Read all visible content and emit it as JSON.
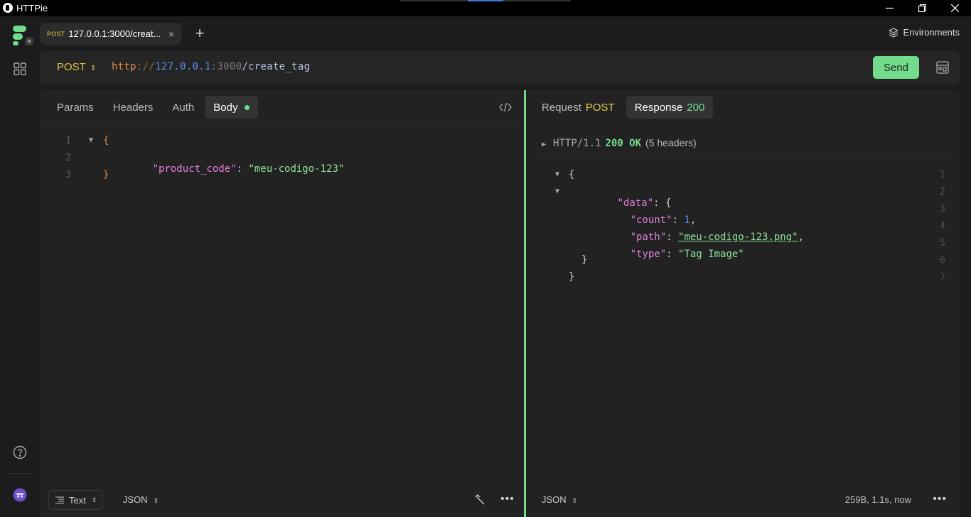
{
  "window": {
    "title": "HTTPie",
    "controls": [
      "minimize-icon",
      "restore-icon",
      "close-icon"
    ]
  },
  "tabs": [
    {
      "method": "POST",
      "label": "127.0.0.1:3000/creat...",
      "close": "×"
    }
  ],
  "new_tab_label": "+",
  "environments_label": "Environments",
  "request": {
    "method": "POST",
    "method_arrows": "⇕",
    "url": {
      "protocol": "http",
      "separator": "://",
      "host": "127.0.0.1",
      "port": ":3000",
      "path": "/create_tag"
    },
    "send_label": "Send",
    "tabs": [
      "Params",
      "Headers",
      "Auth",
      "Body"
    ],
    "active_tab": "Body",
    "body_lines": [
      {
        "num": "1",
        "fold": "▼",
        "text": "{"
      },
      {
        "num": "2",
        "key": "\"product_code\"",
        "colon": ": ",
        "value": "\"meu-codigo-123\""
      },
      {
        "num": "3",
        "text": "}"
      }
    ],
    "footer": {
      "format_label": "Text",
      "type_label": "JSON",
      "arrows": "⇕",
      "more": "•••"
    }
  },
  "response": {
    "request_tab_label": "Request",
    "request_tab_method": "POST",
    "response_tab_label": "Response",
    "response_tab_status": "200",
    "status_line": {
      "toggle": "▶",
      "protocol": "HTTP/1.1",
      "status": "200 OK",
      "headers_count": "(5 headers)"
    },
    "body_lines": [
      {
        "num": "1",
        "fold": "▼",
        "text": "{"
      },
      {
        "num": "2",
        "fold": "▼",
        "key": "\"data\"",
        "colon": ": ",
        "text": "{"
      },
      {
        "num": "3",
        "key": "\"count\"",
        "colon": ": ",
        "number": "1",
        "trail": ","
      },
      {
        "num": "4",
        "key": "\"path\"",
        "colon": ": ",
        "value": "\"meu-codigo-123.png\"",
        "trail": ","
      },
      {
        "num": "5",
        "key": "\"type\"",
        "colon": ": ",
        "value": "\"Tag Image\""
      },
      {
        "num": "6",
        "text": "}"
      },
      {
        "num": "7",
        "text": "}"
      }
    ],
    "footer": {
      "type_label": "JSON",
      "arrows": "⇕",
      "meta": "259B, 1.1s, now",
      "more": "•••"
    }
  },
  "colors": {
    "accent_green": "#73dc8c",
    "method_yellow": "#e2c64b",
    "json_key": "#e27ee0",
    "json_string": "#8fe39d",
    "url_host": "#5b8de8",
    "url_protocol": "#e58a4b"
  }
}
